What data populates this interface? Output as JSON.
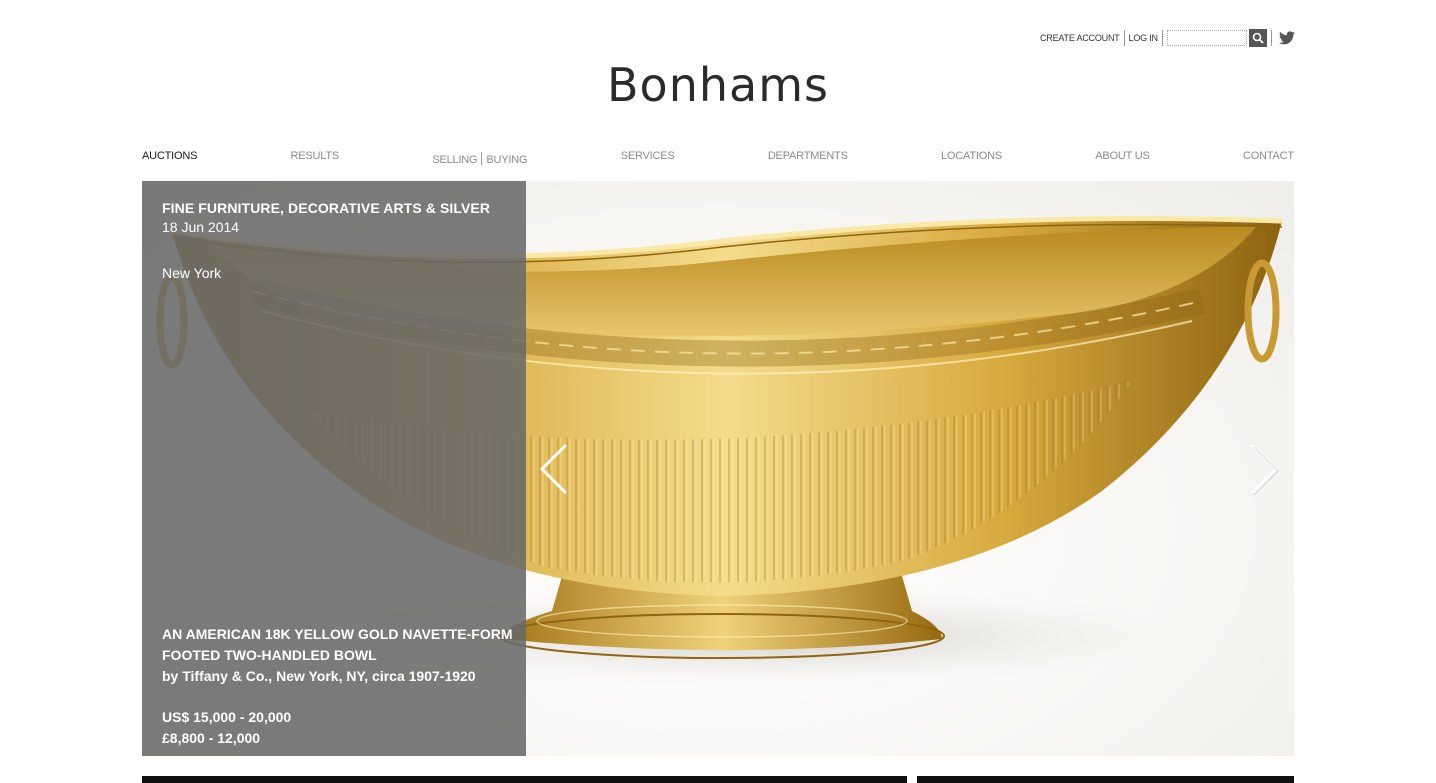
{
  "header": {
    "create_account": "CREATE ACCOUNT",
    "log_in": "LOG IN",
    "search_placeholder": "",
    "logo_text": "Bonhams"
  },
  "nav": {
    "items": [
      {
        "label": "AUCTIONS",
        "active": true
      },
      {
        "label": "RESULTS"
      },
      {
        "label_a": "SELLING",
        "label_b": "BUYING"
      },
      {
        "label": "SERVICES"
      },
      {
        "label": "DEPARTMENTS"
      },
      {
        "label": "LOCATIONS"
      },
      {
        "label": "ABOUT US"
      },
      {
        "label": "CONTACT"
      }
    ]
  },
  "hero": {
    "sale_title": "FINE FURNITURE, DECORATIVE ARTS & SILVER",
    "sale_date": "18 Jun 2014",
    "sale_location": "New York",
    "lot_line1": "AN AMERICAN 18K YELLOW GOLD NAVETTE-FORM FOOTED TWO-HANDLED BOWL",
    "lot_line2": "by Tiffany & Co., New York, NY, circa 1907-1920",
    "estimate_usd": "US$ 15,000 - 20,000",
    "estimate_gbp": "£8,800 - 12,000"
  },
  "colors": {
    "panel": "#696969",
    "gold": "#d4a83a",
    "logo": "#2b2b2b"
  }
}
